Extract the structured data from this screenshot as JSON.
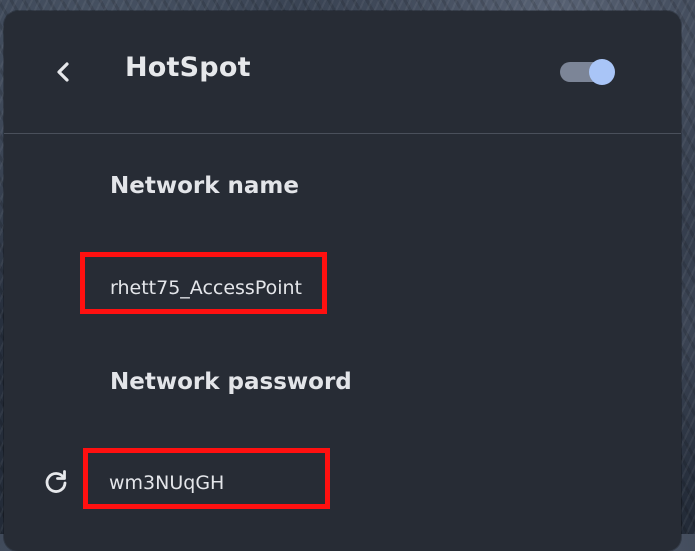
{
  "header": {
    "title": "HotSpot",
    "back_icon": "chevron-left-icon",
    "toggle_state": "on"
  },
  "network_name": {
    "label": "Network name",
    "value": "rhett75_AccessPoint"
  },
  "network_password": {
    "label": "Network password",
    "value": "wm3NUqGH",
    "refresh_icon": "refresh-icon"
  },
  "colors": {
    "panel_bg": "#272c35",
    "text": "#e4e6ea",
    "toggle_knob": "#a9c5f7",
    "toggle_track": "#7c8597",
    "highlight_box": "#ff1010"
  }
}
